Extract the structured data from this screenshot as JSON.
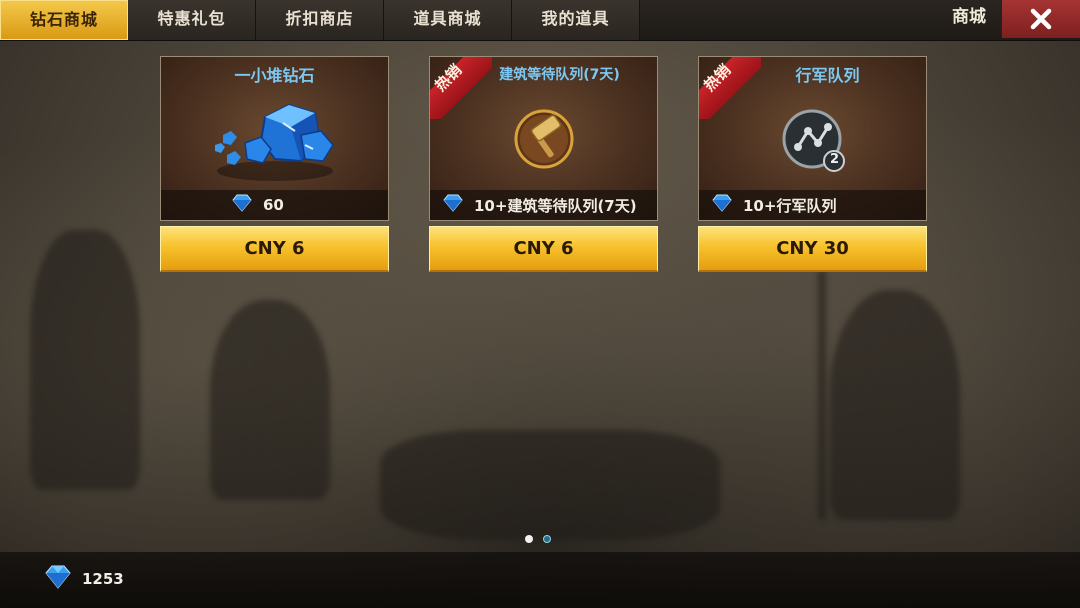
{
  "tabs": [
    {
      "label": "钻石商城",
      "active": true
    },
    {
      "label": "特惠礼包",
      "active": false
    },
    {
      "label": "折扣商店",
      "active": false
    },
    {
      "label": "道具商城",
      "active": false
    },
    {
      "label": "我的道具",
      "active": false
    }
  ],
  "header": {
    "store_title": "商城",
    "close_icon": "close-icon"
  },
  "products": [
    {
      "title": "一小堆钻石",
      "hot": false,
      "icon": "diamond-pile-icon",
      "reward": "60",
      "price": "CNY 6"
    },
    {
      "title": "建筑等待队列(7天)",
      "hot": true,
      "hot_label": "热销",
      "icon": "hammer-icon",
      "reward": "10+建筑等待队列(7天)",
      "price": "CNY 6"
    },
    {
      "title": "行军队列",
      "hot": true,
      "hot_label": "热销",
      "icon": "march-queue-icon",
      "badge": "2",
      "reward": "10+行军队列",
      "price": "CNY 30"
    }
  ],
  "pagination": {
    "pages": 2,
    "current": 1
  },
  "footer": {
    "gem_balance": "1253",
    "gem_icon": "diamond-icon"
  },
  "colors": {
    "accent": "#f7c22d",
    "title_blue": "#7cc8f2",
    "hot_red": "#c8242a",
    "close_red": "#a63434"
  }
}
